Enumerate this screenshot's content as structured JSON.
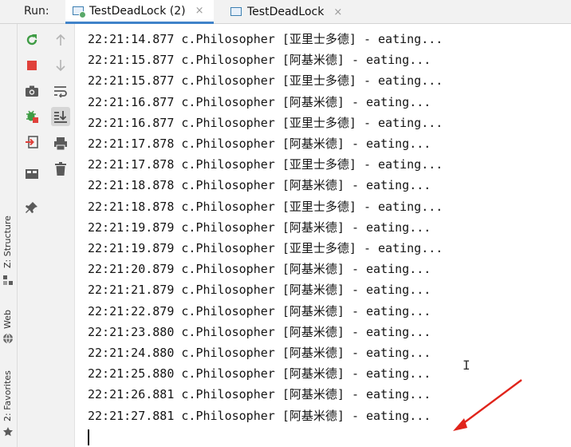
{
  "run_panel": {
    "label": "Run:",
    "tabs": [
      {
        "label": "TestDeadLock (2)",
        "close": "×",
        "active": true
      },
      {
        "label": "TestDeadLock",
        "close": "×",
        "active": false
      }
    ]
  },
  "side_tabs": {
    "structure": "Z: Structure",
    "web": "Web",
    "favorites": "2: Favorites"
  },
  "toolbar_icons": {
    "col1": [
      "rerun-icon",
      "stop-icon",
      "camera-icon",
      "debug-icon",
      "exit-icon",
      "layout-icon",
      "pin-icon"
    ],
    "col2": [
      "up-arrow-icon",
      "down-arrow-icon",
      "soft-wrap-icon",
      "scroll-to-end-icon",
      "print-icon",
      "trash-icon"
    ]
  },
  "console": {
    "lines": [
      {
        "time": "22:21:14.877",
        "logger": "c.Philosopher",
        "name": "亚里士多德",
        "msg": "- eating..."
      },
      {
        "time": "22:21:15.877",
        "logger": "c.Philosopher",
        "name": "阿基米德",
        "msg": "- eating..."
      },
      {
        "time": "22:21:15.877",
        "logger": "c.Philosopher",
        "name": "亚里士多德",
        "msg": "- eating..."
      },
      {
        "time": "22:21:16.877",
        "logger": "c.Philosopher",
        "name": "阿基米德",
        "msg": "- eating..."
      },
      {
        "time": "22:21:16.877",
        "logger": "c.Philosopher",
        "name": "亚里士多德",
        "msg": "- eating..."
      },
      {
        "time": "22:21:17.878",
        "logger": "c.Philosopher",
        "name": "阿基米德",
        "msg": "- eating..."
      },
      {
        "time": "22:21:17.878",
        "logger": "c.Philosopher",
        "name": "亚里士多德",
        "msg": "- eating..."
      },
      {
        "time": "22:21:18.878",
        "logger": "c.Philosopher",
        "name": "阿基米德",
        "msg": "- eating..."
      },
      {
        "time": "22:21:18.878",
        "logger": "c.Philosopher",
        "name": "亚里士多德",
        "msg": "- eating..."
      },
      {
        "time": "22:21:19.879",
        "logger": "c.Philosopher",
        "name": "阿基米德",
        "msg": "- eating..."
      },
      {
        "time": "22:21:19.879",
        "logger": "c.Philosopher",
        "name": "亚里士多德",
        "msg": "- eating..."
      },
      {
        "time": "22:21:20.879",
        "logger": "c.Philosopher",
        "name": "阿基米德",
        "msg": "- eating..."
      },
      {
        "time": "22:21:21.879",
        "logger": "c.Philosopher",
        "name": "阿基米德",
        "msg": "- eating..."
      },
      {
        "time": "22:21:22.879",
        "logger": "c.Philosopher",
        "name": "阿基米德",
        "msg": "- eating..."
      },
      {
        "time": "22:21:23.880",
        "logger": "c.Philosopher",
        "name": "阿基米德",
        "msg": "- eating..."
      },
      {
        "time": "22:21:24.880",
        "logger": "c.Philosopher",
        "name": "阿基米德",
        "msg": "- eating..."
      },
      {
        "time": "22:21:25.880",
        "logger": "c.Philosopher",
        "name": "阿基米德",
        "msg": "- eating..."
      },
      {
        "time": "22:21:26.881",
        "logger": "c.Philosopher",
        "name": "阿基米德",
        "msg": "- eating..."
      },
      {
        "time": "22:21:27.881",
        "logger": "c.Philosopher",
        "name": "阿基米德",
        "msg": "- eating..."
      }
    ]
  },
  "annotation": {
    "color": "#e0241b",
    "shape": "red-arrow-icon"
  }
}
